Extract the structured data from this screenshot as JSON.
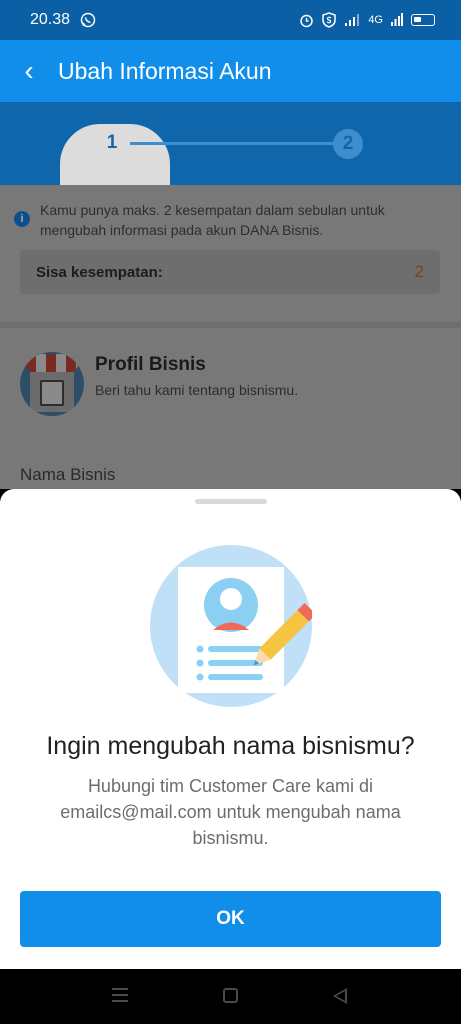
{
  "status_bar": {
    "time": "20.38",
    "network": "4G",
    "icons": [
      "whatsapp-icon",
      "alarm-icon",
      "vpn-shield-icon",
      "signal-icon",
      "battery-icon"
    ]
  },
  "app_bar": {
    "title": "Ubah Informasi Akun",
    "back_icon": "back-arrow-icon"
  },
  "stepper": {
    "steps": [
      "1",
      "2"
    ],
    "current_step": 1
  },
  "info_banner": {
    "text": "Kamu punya maks. 2 kesempatan dalam sebulan untuk mengubah informasi pada akun DANA Bisnis."
  },
  "remaining": {
    "label": "Sisa kesempatan:",
    "value": "2"
  },
  "profile_section": {
    "title": "Profil Bisnis",
    "subtitle": "Beri tahu kami tentang bisnismu.",
    "field_label": "Nama Bisnis"
  },
  "bottom_sheet": {
    "title": "Ingin mengubah nama bisnismu?",
    "description": "Hubungi tim Customer Care kami di emailcs@mail.com untuk mengubah nama bisnismu.",
    "ok_label": "OK"
  },
  "colors": {
    "primary": "#108ee9",
    "status_bar": "#0a5fa5",
    "stepper_bg": "#0f66ab",
    "accent_value": "#e07b00"
  }
}
